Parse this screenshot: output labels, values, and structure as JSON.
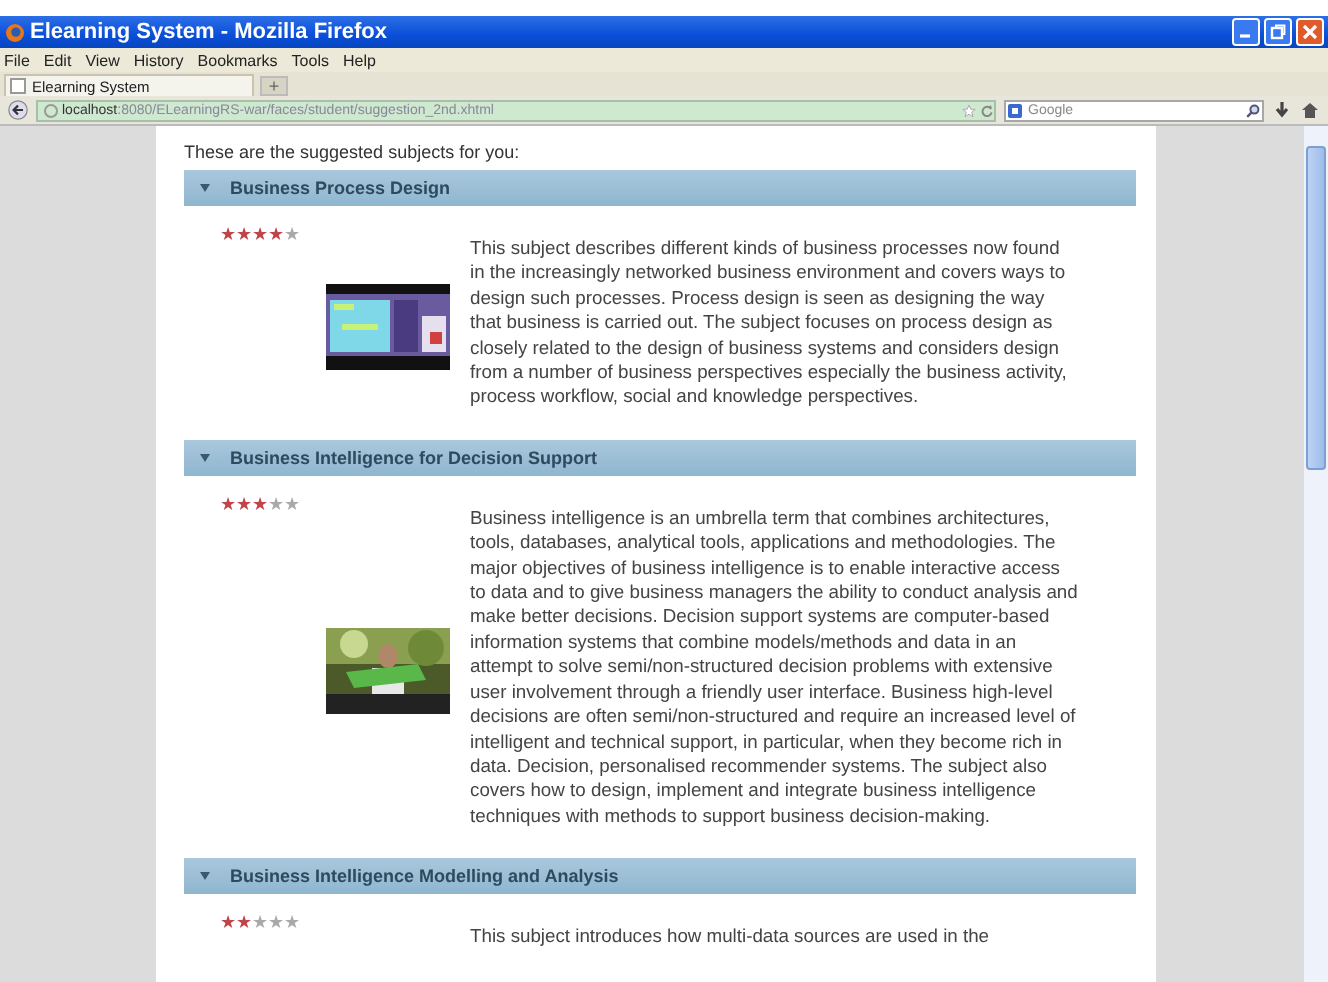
{
  "window": {
    "title": "Elearning System - Mozilla Firefox"
  },
  "menu": [
    "File",
    "Edit",
    "View",
    "History",
    "Bookmarks",
    "Tools",
    "Help"
  ],
  "tabs": [
    {
      "label": "Elearning System",
      "selected": true
    }
  ],
  "new_tab": "+",
  "address_bar": {
    "host": "localhost",
    "path": ":8080/ELearningRS-war/faces/student/suggestion_2nd.xhtml"
  },
  "search": {
    "placeholder": "Google"
  },
  "heading": "These are the suggested subjects for you:",
  "subjects": [
    {
      "title": "Business Process Design",
      "expanded": true,
      "stars": 4,
      "description": "This subject describes different kinds of business processes now found in the increasingly networked business environment and covers ways to design such processes. Process design is seen as designing the way that business is carried out. The subject focuses on process design as closely related to the design of business systems and considers design from a number of business perspectives especially the business activity, process workflow, social and knowledge perspectives."
    },
    {
      "title": "Business Intelligence for Decision Support",
      "expanded": true,
      "stars": 3,
      "description": "Business intelligence is an umbrella term that combines architectures, tools, databases, analytical tools, applications and methodologies. The major objectives of business intelligence is to enable interactive access to data and to give business managers the ability to conduct analysis and make better decisions. Decision support systems are computer-based information systems that combine models/methods and data in an attempt to solve semi/non-structured decision problems with extensive user involvement through a friendly user interface. Business high-level decisions are often semi/non-structured and require an increased level of intelligent and technical support, in particular, when they become rich in data. Decision, personalised recommender systems. The subject also covers how to design, implement and integrate business intelligence techniques with methods to support business decision-making."
    },
    {
      "title": "Business Intelligence Modelling and Analysis",
      "expanded": true,
      "stars": 2,
      "description": "This subject introduces how multi-data sources are used in the"
    }
  ]
}
